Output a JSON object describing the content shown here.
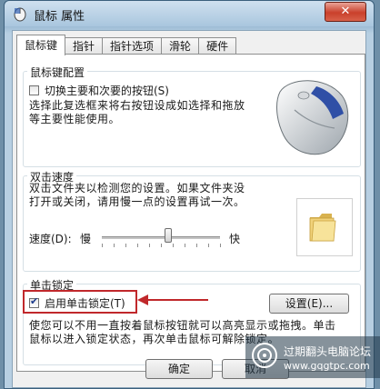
{
  "window": {
    "title": "鼠标 属性",
    "close_symbol": "✕"
  },
  "tabs": [
    {
      "label": "鼠标键",
      "active": true
    },
    {
      "label": "指针",
      "active": false
    },
    {
      "label": "指针选项",
      "active": false
    },
    {
      "label": "滑轮",
      "active": false
    },
    {
      "label": "硬件",
      "active": false
    }
  ],
  "button_config": {
    "title": "鼠标键配置",
    "switch_label": "切换主要和次要的按钮(S)",
    "switch_checked": false,
    "description_line1": "选择此复选框来将右按钮设成如选择和拖放",
    "description_line2": "等主要性能使用。"
  },
  "double_click": {
    "title": "双击速度",
    "description_line1": "双击文件夹以检测您的设置。如果文件夹没",
    "description_line2": "打开或关闭，请用慢一点的设置再试一次。",
    "speed_label": "速度(D):",
    "slow_label": "慢",
    "fast_label": "快",
    "slider_value_fraction": 0.56
  },
  "click_lock": {
    "title": "单击锁定",
    "enable_label": "启用单击锁定(T)",
    "enable_checked": true,
    "settings_button": "设置(E)...",
    "description_line1": "使您可以不用一直按着鼠标按钮就可以高亮显示或拖拽。单击",
    "description_line2": "鼠标以进入锁定状态，再次单击鼠标可解除锁定。"
  },
  "footer": {
    "ok_button": "确定",
    "cancel_button": "取消"
  },
  "watermark": {
    "line1": "过期翻头电脑论坛",
    "line2": "www.gqgtpc.com"
  },
  "colors": {
    "highlight": "#c0282b",
    "title_bar": "#a9c6de",
    "close_button": "#c9402b"
  }
}
